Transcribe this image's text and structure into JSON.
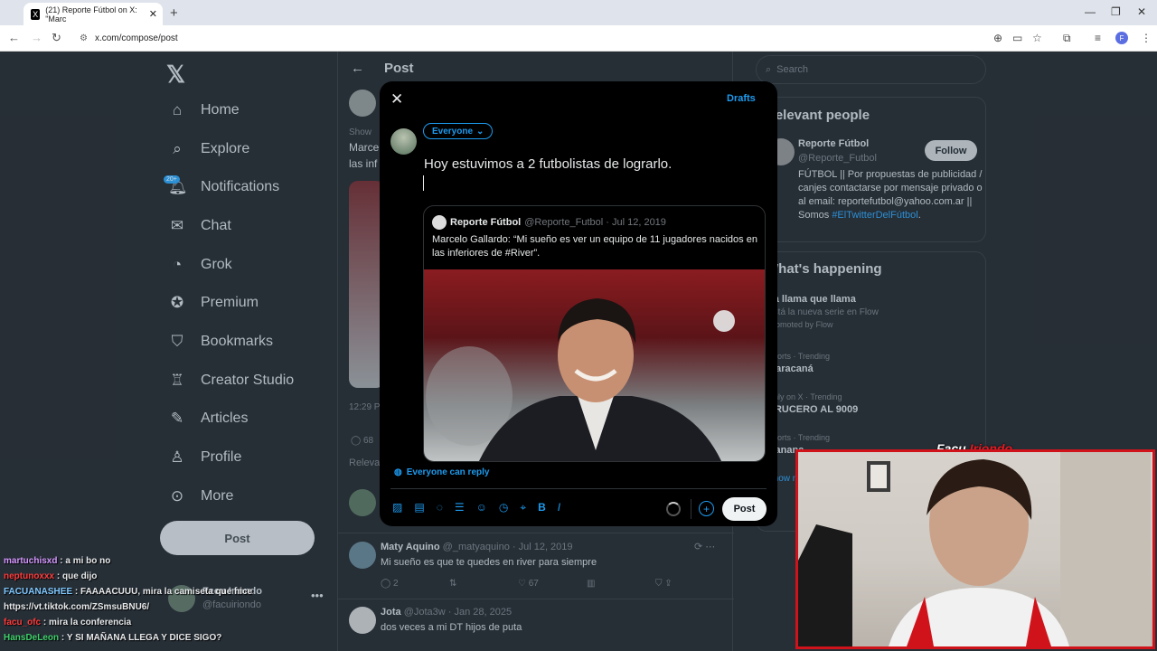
{
  "browser": {
    "tab_title": "(21) Reporte Fútbol on X: \"Marc",
    "tab_favicon": "X",
    "url": "x.com/compose/post",
    "profile_initial": "F"
  },
  "x": {
    "nav": [
      {
        "label": "Home",
        "icon": "home-icon"
      },
      {
        "label": "Explore",
        "icon": "search-icon"
      },
      {
        "label": "Notifications",
        "icon": "bell-icon"
      },
      {
        "label": "Chat",
        "icon": "mail-icon"
      },
      {
        "label": "Grok",
        "icon": "grok-icon"
      },
      {
        "label": "Premium",
        "icon": "premium-icon"
      },
      {
        "label": "Bookmarks",
        "icon": "bookmark-icon"
      },
      {
        "label": "Creator Studio",
        "icon": "creator-icon"
      },
      {
        "label": "Articles",
        "icon": "article-icon"
      },
      {
        "label": "Profile",
        "icon": "person-icon"
      },
      {
        "label": "More",
        "icon": "more-icon"
      }
    ],
    "notif_badge": "20+",
    "post_button": "Post",
    "account": {
      "name": "Facu Iriondo",
      "handle": "@facuiriondo"
    }
  },
  "midcol": {
    "title": "Post",
    "partial": {
      "show": "Show",
      "line1": "Marce",
      "line2": "las inf",
      "time": "12:29 P",
      "reply_count": "68",
      "relevant": "Relevan"
    },
    "tweets": [
      {
        "name": "Maty Aquino",
        "handle": "@_matyaquino · Jul 12, 2019",
        "text": "Mi sueño es que te quedes en river para siempre",
        "replies": "2",
        "likes": "67"
      },
      {
        "name": "Jota",
        "handle": "@Jota3w · Jan 28, 2025",
        "text": "dos veces a mi DT hijos de puta"
      }
    ]
  },
  "rightcol": {
    "search_placeholder": "Search",
    "relevant_title": "Relevant people",
    "person": {
      "name": "Reporte Fútbol",
      "handle": "@Reporte_Futbol",
      "follow": "Follow",
      "bio": "FÚTBOL || Por propuestas de publicidad / canjes contactarse por mensaje privado o al email: reportefutbol@yahoo.com.ar || Somos",
      "tag": "#ElTwitterDelFútbol",
      "tag_end": "."
    },
    "happening_title": "What's happening",
    "trends": [
      {
        "meta": "",
        "title": "La llama que llama",
        "sub": "Está la nueva serie en Flow",
        "promo": "Promoted by Flow"
      },
      {
        "meta": "Sports · Trending",
        "title": "Maracaná"
      },
      {
        "meta": "Only on X · Trending",
        "title": "CRUCERO AL 9009"
      },
      {
        "meta": "Sports · Trending",
        "title": "Ganana"
      }
    ],
    "show_more": "Show more"
  },
  "composer": {
    "drafts": "Drafts",
    "audience": "Everyone",
    "text": "Hoy estuvimos a 2 futbolistas de lograrlo.",
    "quote": {
      "name": "Reporte Fútbol",
      "meta": "@Reporte_Futbol · Jul 12, 2019",
      "text": "Marcelo Gallardo: “Mi sueño es ver un equipo de 11 jugadores nacidos en las inferiores de #River”."
    },
    "reply_setting": "Everyone can reply",
    "post_label": "Post"
  },
  "stream": {
    "cam_title_white": "Facu ",
    "cam_title_red": "Iriondo",
    "chat": [
      {
        "user": "martuchisxd",
        "msg": ": a mi bo no"
      },
      {
        "user": "neptunoxxx",
        "msg": ": que dijo"
      },
      {
        "user": "FACUANASHEE",
        "msg": ": FAAAACUUU, mira la camiseta que hice"
      },
      {
        "user": "",
        "msg": "https://vt.tiktok.com/ZSmsuBNU6/"
      },
      {
        "user": "facu_ofc",
        "msg": ": mira la conferencia"
      },
      {
        "user": "HansDeLeon",
        "msg": ": Y SI MAÑANA LLEGA Y DICE SIGO?"
      }
    ]
  },
  "colors": {
    "accent": "#1d9bf0",
    "bg": "#000000",
    "stream_red": "#d0131b"
  }
}
